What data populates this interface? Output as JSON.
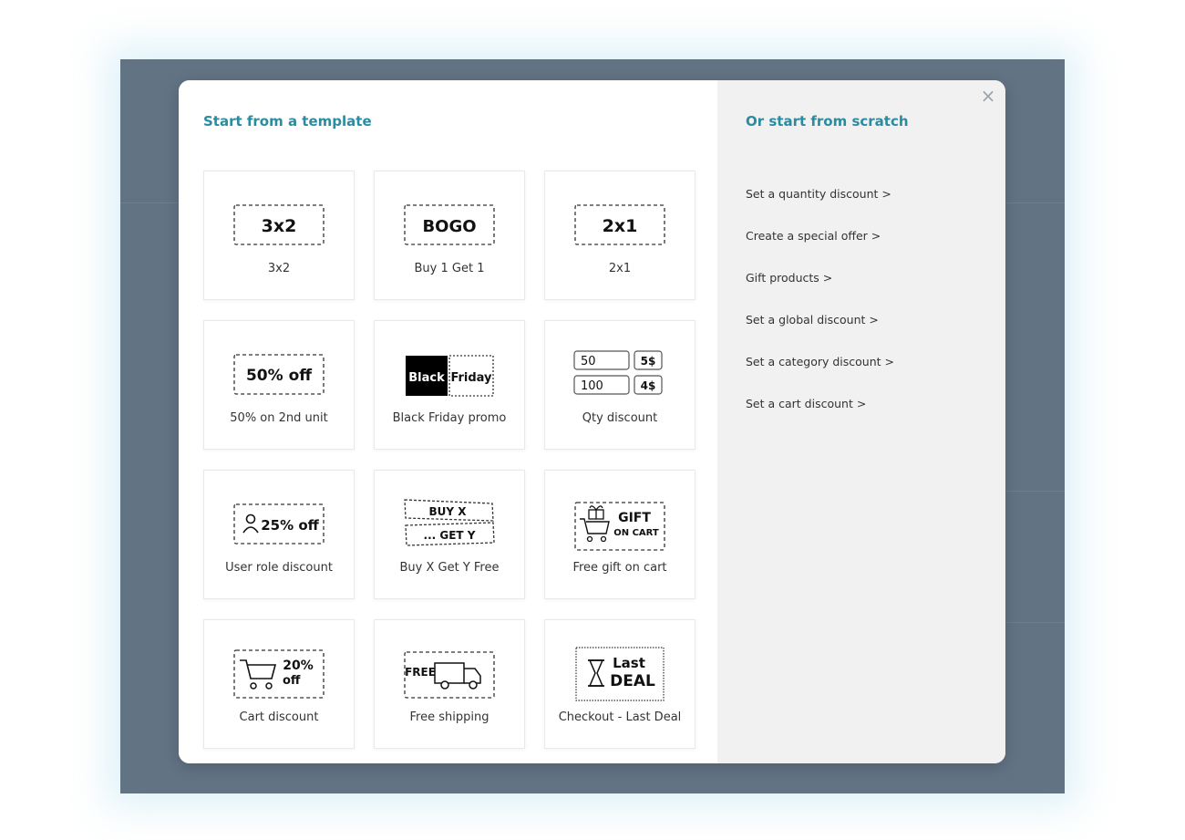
{
  "left": {
    "title": "Start from a template"
  },
  "right": {
    "title": "Or start from scratch"
  },
  "close_symbol": "×",
  "templates": [
    {
      "label": "3x2",
      "icon": "3x2-badge-icon",
      "icon_text": "3x2"
    },
    {
      "label": "Buy 1 Get 1",
      "icon": "bogo-badge-icon",
      "icon_text": "BOGO"
    },
    {
      "label": "2x1",
      "icon": "2x1-badge-icon",
      "icon_text": "2x1"
    },
    {
      "label": "50% on 2nd unit",
      "icon": "percent-off-badge-icon",
      "icon_text": "50% off"
    },
    {
      "label": "Black Friday promo",
      "icon": "black-friday-badge-icon",
      "icon_text": [
        "Black",
        "Friday"
      ]
    },
    {
      "label": "Qty discount",
      "icon": "qty-table-icon",
      "icon_text": [
        "50",
        "5$",
        "100",
        "4$"
      ]
    },
    {
      "label": "User role discount",
      "icon": "user-role-badge-icon",
      "icon_text": "25% off"
    },
    {
      "label": "Buy X Get Y Free",
      "icon": "buy-x-get-y-ticket-icon",
      "icon_text": [
        "BUY X",
        "... GET Y"
      ]
    },
    {
      "label": "Free gift on cart",
      "icon": "gift-cart-badge-icon",
      "icon_text": [
        "GIFT",
        "ON CART"
      ]
    },
    {
      "label": "Cart discount",
      "icon": "cart-discount-badge-icon",
      "icon_text": [
        "20%",
        "off"
      ]
    },
    {
      "label": "Free shipping",
      "icon": "free-shipping-truck-icon",
      "icon_text": "FREE"
    },
    {
      "label": "Checkout - Last Deal",
      "icon": "hourglass-last-deal-icon",
      "icon_text": [
        "Last",
        "DEAL"
      ]
    }
  ],
  "scratch_links": [
    "Set a quantity discount >",
    "Create a special offer >",
    "Gift products >",
    "Set a global discount >",
    "Set a category discount >",
    "Set a cart discount >"
  ],
  "colors": {
    "accent": "#2a8ca1",
    "backdrop": "#627384",
    "right_pane": "#f1f1f1"
  }
}
